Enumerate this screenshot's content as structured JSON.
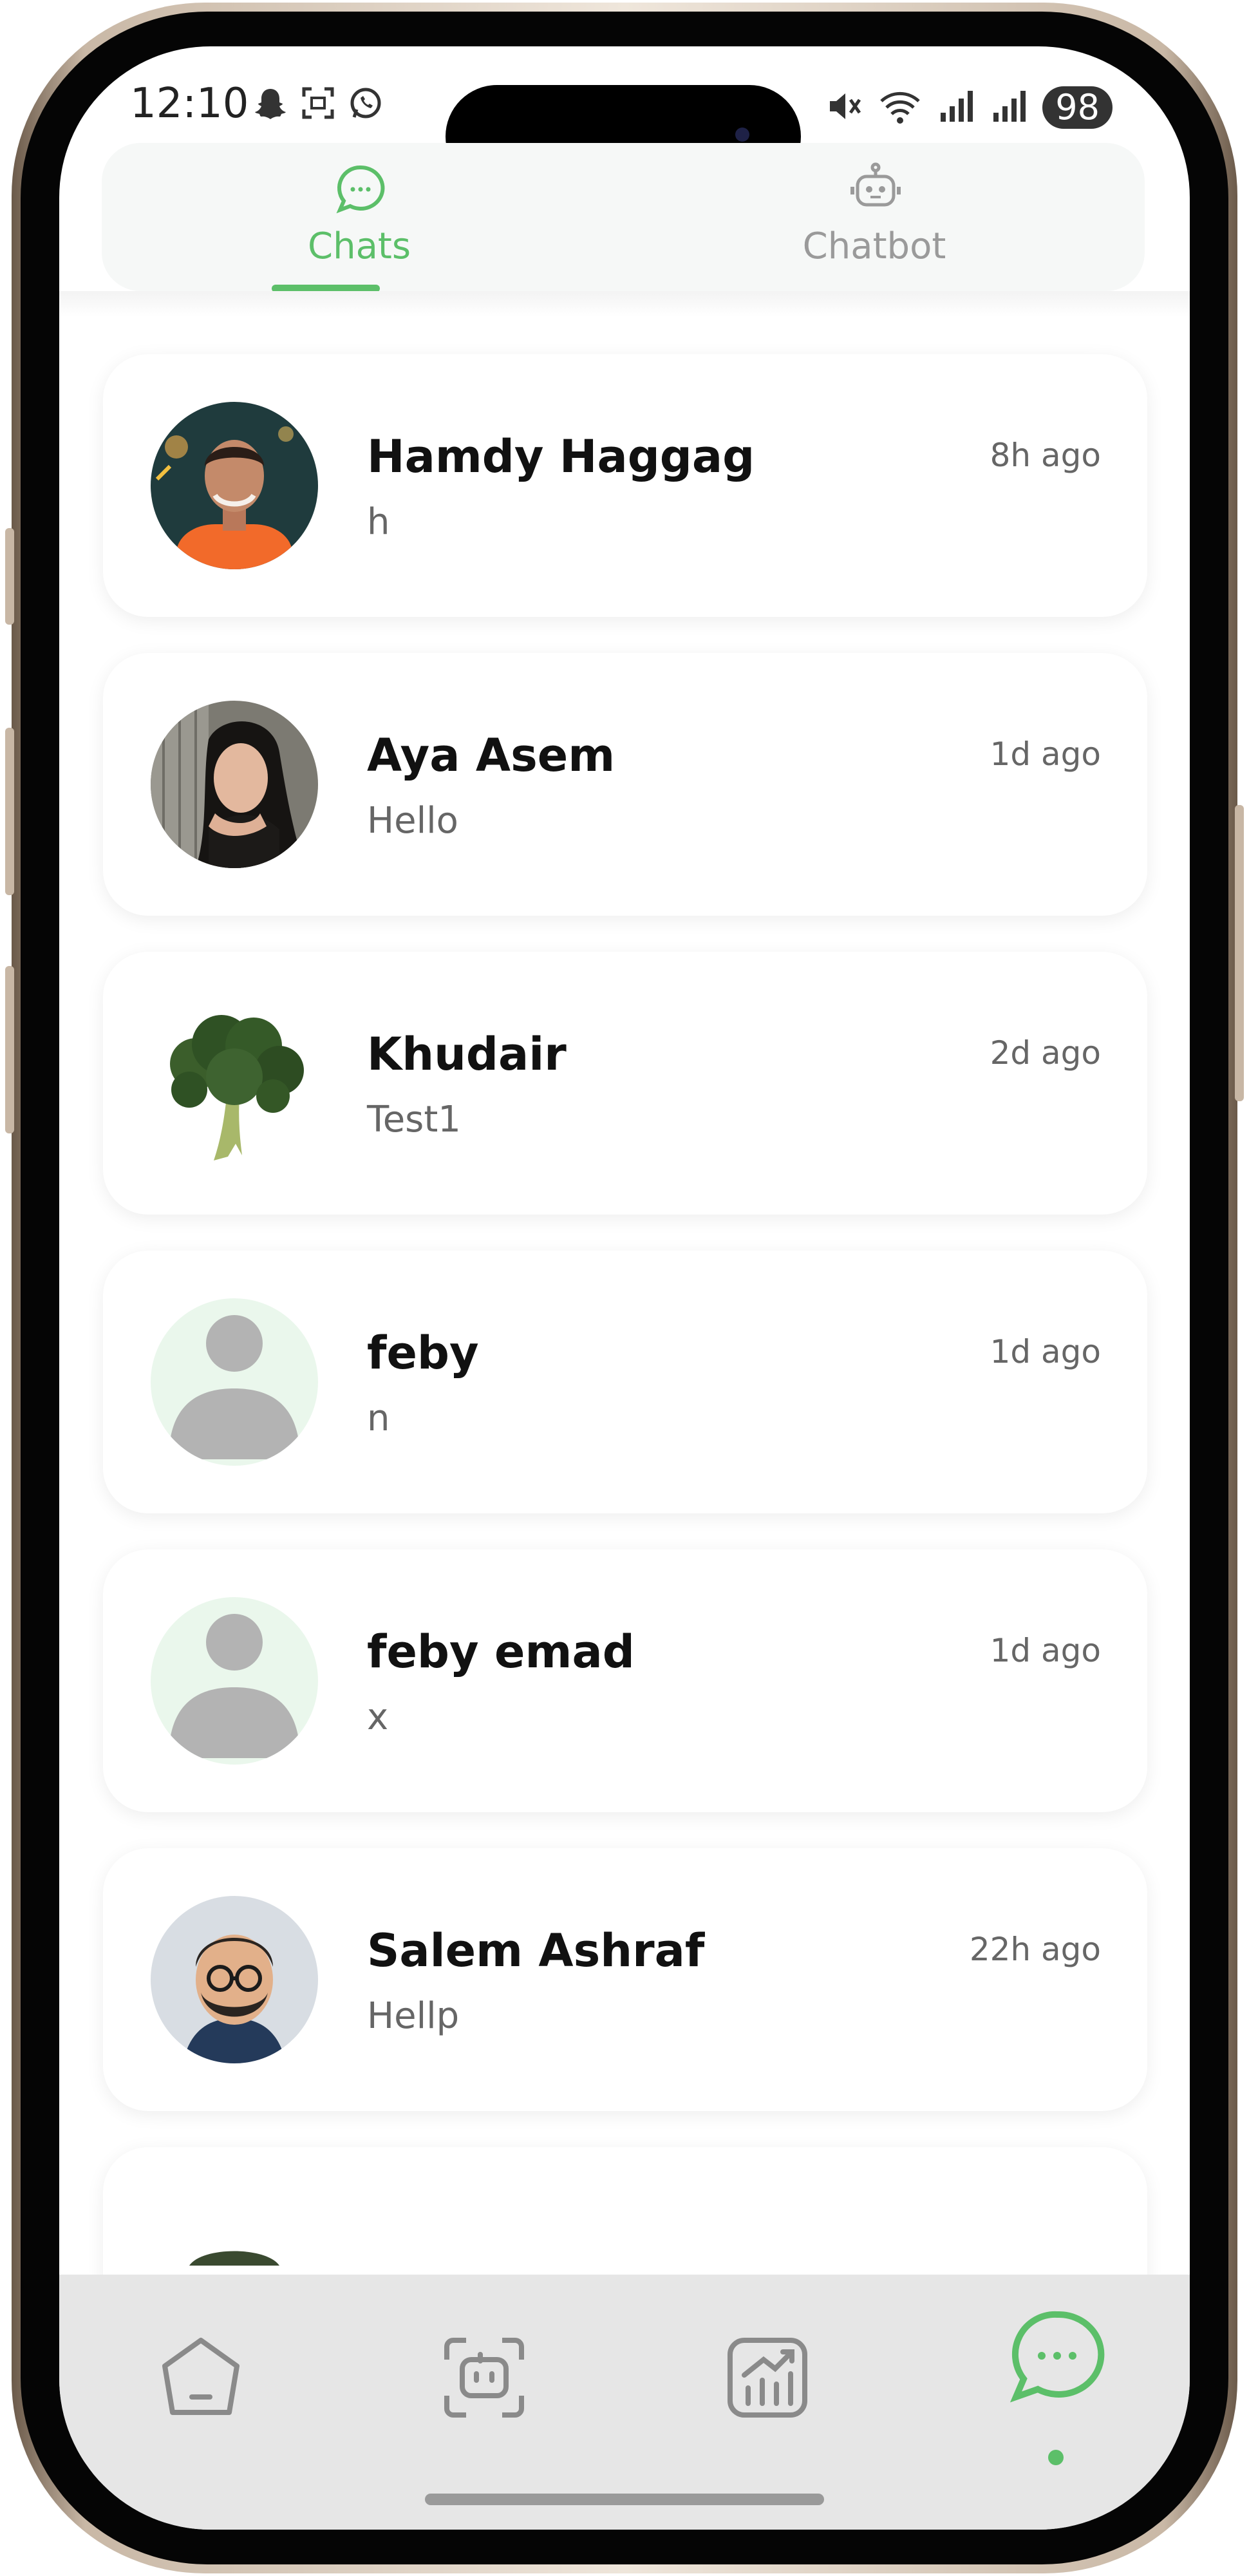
{
  "status_bar": {
    "time": "12:10",
    "battery": "98"
  },
  "tabs": [
    {
      "label": "Chats",
      "icon": "chat-bubble-icon",
      "active": true
    },
    {
      "label": "Chatbot",
      "icon": "robot-icon",
      "active": false
    }
  ],
  "chats": [
    {
      "name": "Hamdy Haggag",
      "message": "h",
      "time": "8h ago",
      "avatar": "photo-man-orange"
    },
    {
      "name": "Aya Asem",
      "message": "Hello",
      "time": "1d ago",
      "avatar": "photo-woman"
    },
    {
      "name": "Khudair",
      "message": "Test1",
      "time": "2d ago",
      "avatar": "broccoli"
    },
    {
      "name": "feby",
      "message": "n",
      "time": "1d ago",
      "avatar": "default-person"
    },
    {
      "name": "feby emad",
      "message": "x",
      "time": "1d ago",
      "avatar": "default-person"
    },
    {
      "name": "Salem Ashraf",
      "message": "Hellp",
      "time": "22h ago",
      "avatar": "cartoon-man"
    }
  ],
  "bottom_nav": [
    {
      "icon": "home-icon",
      "active": false
    },
    {
      "icon": "scan-robot-icon",
      "active": false
    },
    {
      "icon": "stats-icon",
      "active": false
    },
    {
      "icon": "chat-bubble-icon",
      "active": true
    }
  ],
  "colors": {
    "accent": "#5cbf69",
    "inactive": "#9a9a9a",
    "nav_background": "#e6e6e6"
  }
}
